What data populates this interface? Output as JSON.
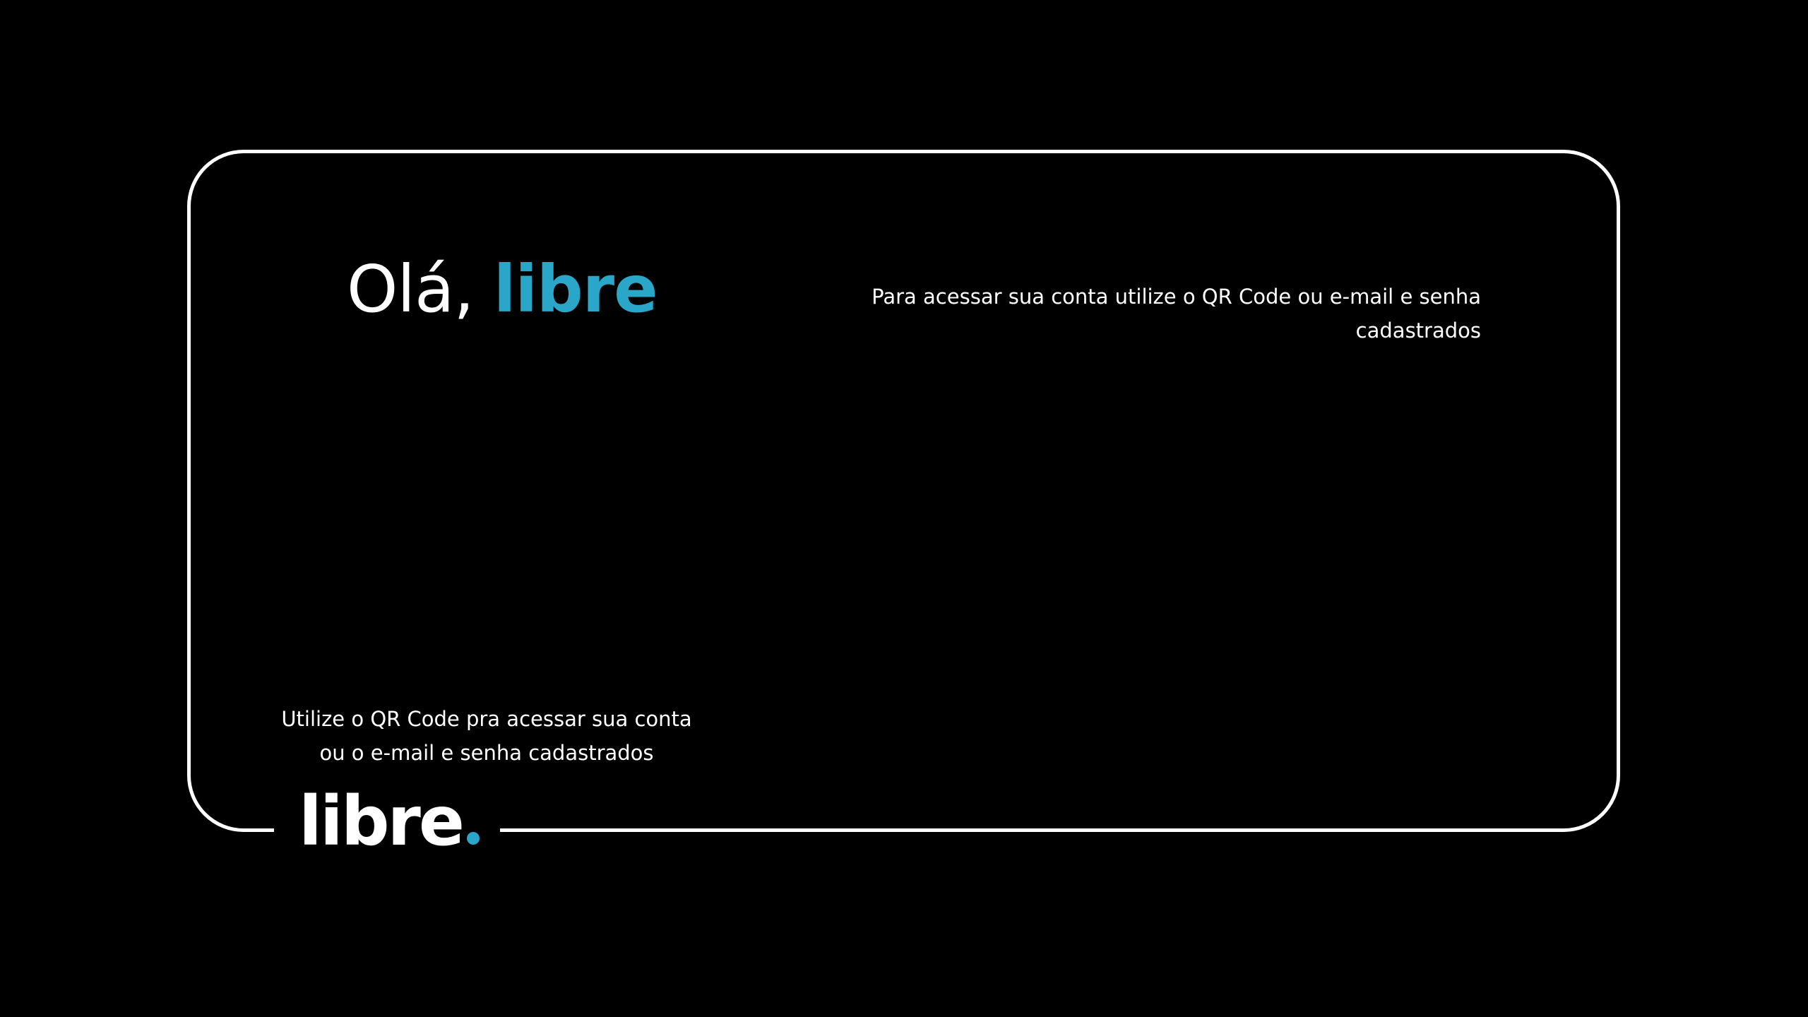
{
  "colors": {
    "background": "#000000",
    "text": "#ffffff",
    "accent": "#2aa6c8",
    "frame": "#ffffff"
  },
  "greeting": {
    "prefix": "Olá, ",
    "name": "libre"
  },
  "instructions": {
    "text": "Para acessar sua conta utilize o QR Code ou e-mail e senha cadastrados"
  },
  "qr_caption": {
    "line1": "Utilize o QR Code pra acessar sua conta",
    "line2": "ou o e-mail e senha cadastrados"
  },
  "logo": {
    "text": "libre",
    "icon": "libre-logo"
  }
}
